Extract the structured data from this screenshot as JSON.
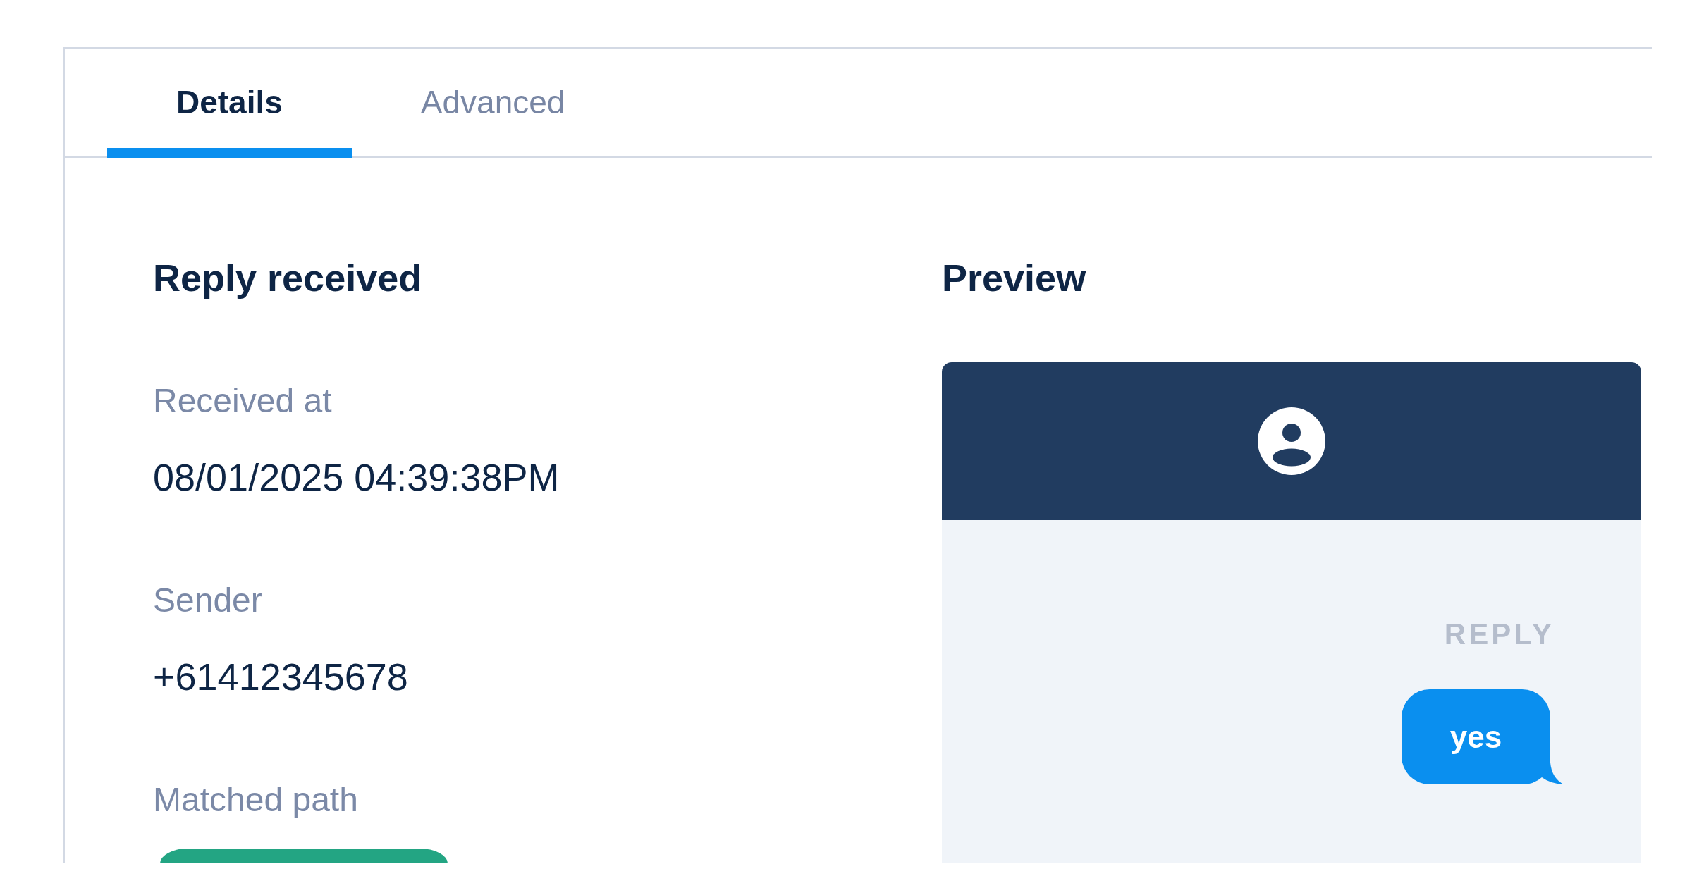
{
  "tabs": [
    {
      "label": "Details",
      "selected": true
    },
    {
      "label": "Advanced",
      "selected": false
    }
  ],
  "details": {
    "title": "Reply received",
    "fields": [
      {
        "kind": "text",
        "label": "Received at",
        "value": "08/01/2025 04:39:38PM"
      },
      {
        "kind": "text",
        "label": "Sender",
        "value": "+61412345678"
      },
      {
        "kind": "tag",
        "label": "Matched path"
      }
    ]
  },
  "preview": {
    "title": "Preview",
    "direction_label": "REPLY",
    "message": "yes"
  }
}
